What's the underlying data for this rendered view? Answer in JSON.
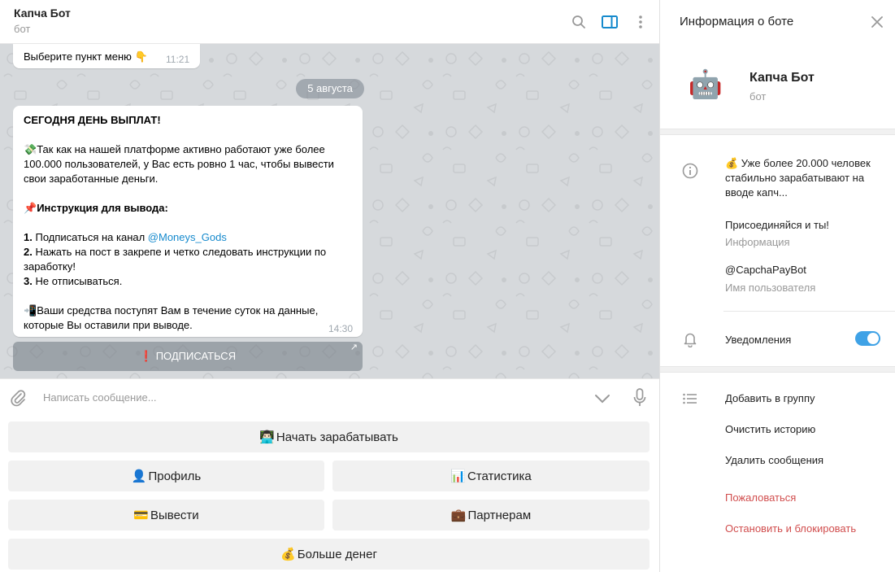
{
  "header": {
    "title": "Капча Бот",
    "subtitle": "бот"
  },
  "messages": {
    "first": {
      "text": "Выберите пункт меню",
      "emoji": "👇",
      "time": "11:21"
    },
    "date_pill": "5 августа",
    "main": {
      "title": "СЕГОДНЯ ДЕНЬ ВЫПЛАТ!",
      "para1_emoji": "💸",
      "para1": "Так как на нашей платформе активно работают уже более 100.000 пользователей, у Вас есть ровно 1 час, чтобы вывести свои заработанные деньги.",
      "instr_emoji": "📌",
      "instr_title": "Инструкция для вывода:",
      "step1_num": "1.",
      "step1_text": "Подписаться на канал ",
      "step1_link": "@Moneys_Gods",
      "step2_num": "2.",
      "step2_text": "Нажать на пост в закрепе и четко следовать инструкции по заработку!",
      "step3_num": "3.",
      "step3_text": "Не отписываться.",
      "para2_emoji": "📲",
      "para2": "Ваши средства поступят Вам в течение суток на данные, которые Вы оставили при выводе.",
      "time": "14:30"
    },
    "inline_button": {
      "emoji": "❗",
      "label": "ПОДПИСАТЬСЯ"
    }
  },
  "composer": {
    "placeholder": "Написать сообщение..."
  },
  "keyboard": {
    "start": {
      "emoji": "👨🏻‍💻",
      "label": "Начать зарабатывать"
    },
    "profile": {
      "emoji": "👤",
      "label": "Профиль"
    },
    "stats": {
      "emoji": "📊",
      "label": "Статистика"
    },
    "withdraw": {
      "emoji": "💳",
      "label": "Вывести"
    },
    "partners": {
      "emoji": "💼",
      "label": "Партнерам"
    },
    "more": {
      "emoji": "💰",
      "label": "Больше денег"
    }
  },
  "info_panel": {
    "title": "Информация о боте",
    "avatar_emoji": "🤖",
    "bot_name": "Капча Бот",
    "bot_type": "бот",
    "about_line1": "💰 Уже более 20.000 человек",
    "about_line2": "стабильно зарабатывают на",
    "about_line3": "вводе капч...",
    "about_line4": "Присоединяйся и ты!",
    "about_label": "Информация",
    "username": "@CapchaPayBot",
    "username_label": "Имя пользователя",
    "notifications_label": "Уведомления",
    "notifications_on": true,
    "actions": {
      "add_to_group": "Добавить в группу",
      "clear_history": "Очистить историю",
      "delete_messages": "Удалить сообщения",
      "report": "Пожаловаться",
      "stop_block": "Остановить и блокировать"
    }
  },
  "colors": {
    "accent": "#168acd",
    "toggle": "#3fa2e6",
    "danger": "#d14e4e",
    "history_bg": "#d6d9dc"
  }
}
